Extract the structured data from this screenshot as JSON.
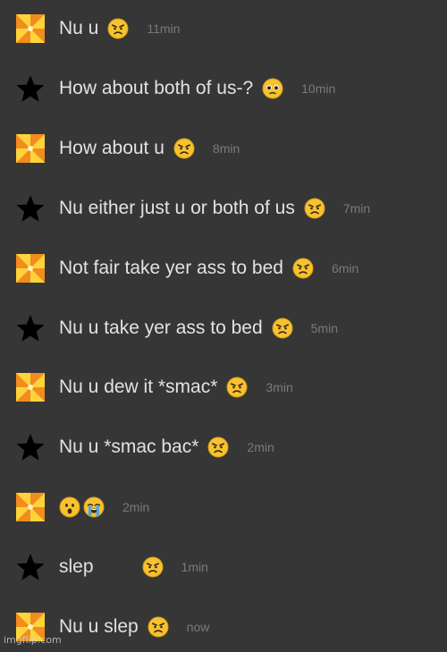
{
  "messages": [
    {
      "avatar": "pinwheel",
      "text": "Nu u",
      "emojis": [
        "angry-face"
      ],
      "time": "11min"
    },
    {
      "avatar": "star",
      "text": "How about both of us-?",
      "emojis": [
        "pleading-face"
      ],
      "time": "10min"
    },
    {
      "avatar": "pinwheel",
      "text": "How about u",
      "emojis": [
        "angry-face"
      ],
      "time": "8min"
    },
    {
      "avatar": "star",
      "text": "Nu either just u or both of us",
      "emojis": [
        "angry-face"
      ],
      "time": "7min"
    },
    {
      "avatar": "pinwheel",
      "text": "Not fair take yer ass to bed",
      "emojis": [
        "angry-face"
      ],
      "time": "6min"
    },
    {
      "avatar": "star",
      "text": "Nu u take yer ass to bed",
      "emojis": [
        "angry-face"
      ],
      "time": "5min"
    },
    {
      "avatar": "pinwheel",
      "text": "Nu u dew it *smac*",
      "emojis": [
        "angry-face"
      ],
      "time": "3min"
    },
    {
      "avatar": "star",
      "text": "Nu u *smac bac*",
      "emojis": [
        "angry-face"
      ],
      "time": "2min"
    },
    {
      "avatar": "pinwheel",
      "text": "",
      "emojis": [
        "surprised-face",
        "crying-face"
      ],
      "time": "2min"
    },
    {
      "avatar": "star",
      "text": "slep",
      "emojis": [
        "angry-face"
      ],
      "time": "1min"
    },
    {
      "avatar": "pinwheel",
      "text": "Nu u slep",
      "emojis": [
        "angry-face"
      ],
      "time": "now"
    }
  ],
  "watermark": "imgflip.com",
  "colors": {
    "background": "#363636",
    "text": "#e2e2e2",
    "time": "#7a7a7a",
    "pinwheel_orange": "#f28c1e",
    "pinwheel_yellow": "#ffd43a"
  }
}
